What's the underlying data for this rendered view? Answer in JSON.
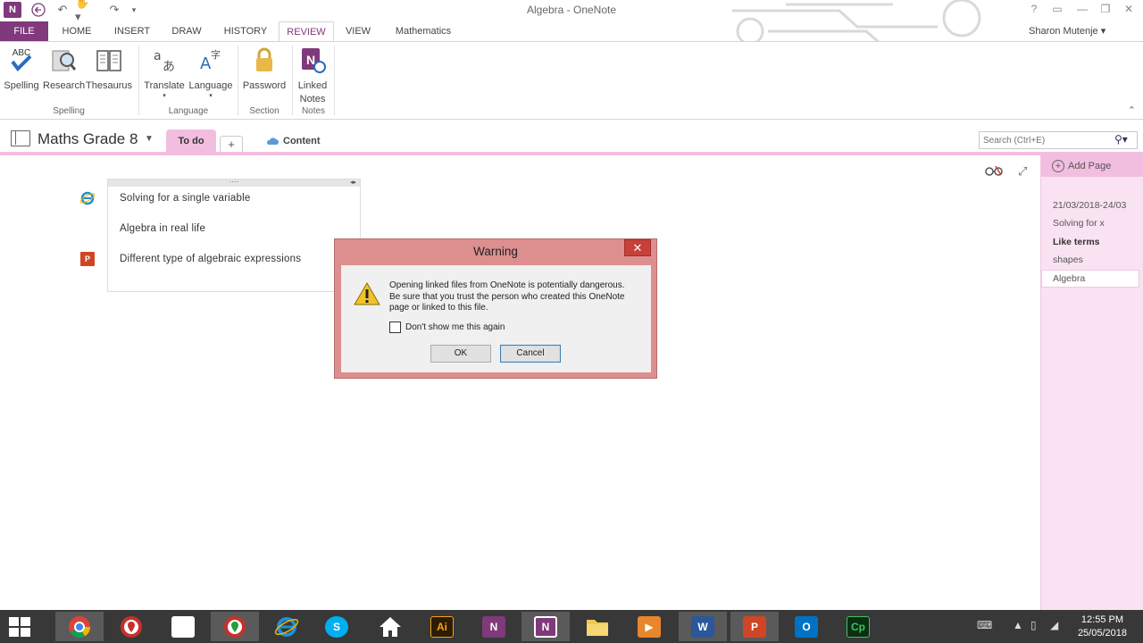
{
  "window": {
    "title": "Algebra - OneNote",
    "user": "Sharon Mutenje"
  },
  "ribbon_tabs": [
    "FILE",
    "HOME",
    "INSERT",
    "DRAW",
    "HISTORY",
    "REVIEW",
    "VIEW",
    "Mathematics"
  ],
  "ribbon": {
    "spelling": "Spelling",
    "spelling_icon_text": "ABC",
    "research": "Research",
    "thesaurus": "Thesaurus",
    "translate": "Translate",
    "language": "Language",
    "password": "Password",
    "linked_notes_1": "Linked",
    "linked_notes_2": "Notes",
    "group_spelling": "Spelling",
    "group_language": "Language",
    "group_section": "Section",
    "group_notes": "Notes"
  },
  "notebook": {
    "name": "Maths Grade 8",
    "section_active": "To do",
    "section_add": "+",
    "content_link": "Content",
    "search_placeholder": "Search (Ctrl+E)"
  },
  "note": {
    "lines": [
      "Solving for a single variable",
      "Algebra in real life",
      "Different type of algebraic expressions"
    ],
    "ppt_icon_text": "P"
  },
  "pages": {
    "add_page": "Add Page",
    "items": [
      "21/03/2018-24/03",
      "Solving for x",
      "Like terms",
      "shapes",
      "Algebra"
    ]
  },
  "dialog": {
    "title": "Warning",
    "message": "Opening linked files from OneNote is potentially dangerous. Be sure that you trust the person who created this OneNote page or linked to this file.",
    "checkbox_label": "Don't show me this again",
    "ok": "OK",
    "cancel": "Cancel",
    "close": "✕"
  },
  "taskbar": {
    "time": "12:55 PM",
    "date": "25/05/2018",
    "illustrator_text": "Ai",
    "captivate_text": "Cp",
    "onenote_text": "N",
    "word_text": "W",
    "powerpoint_text": "P",
    "outlook_text": "O"
  },
  "colors": {
    "onenote_purple": "#80397b",
    "section_pink": "#f2bedf",
    "dialog_border": "#dd8e8e",
    "close_red": "#c7403a"
  }
}
